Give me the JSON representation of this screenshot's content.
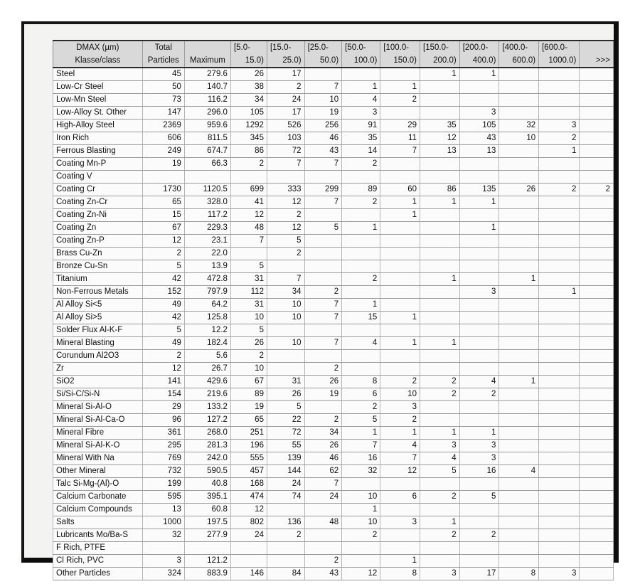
{
  "table": {
    "header": {
      "row1": [
        "DMAX (µm)",
        "Total",
        "",
        "[5.0-",
        "[15.0-",
        "[25.0-",
        "[50.0-",
        "[100.0-",
        "[150.0-",
        "[200.0-",
        "[400.0-",
        "[600.0-",
        ""
      ],
      "row2": [
        "Klasse/class",
        "Particles",
        "Maximum",
        "15.0)",
        "25.0)",
        "50.0)",
        "100.0)",
        "150.0)",
        "200.0)",
        "400.0)",
        "600.0)",
        "1000.0)",
        ">>>"
      ]
    },
    "rows": [
      {
        "label": "Steel",
        "total": "45",
        "maximum": "279.6",
        "bins": [
          "26",
          "17",
          "",
          "",
          "",
          "1",
          "1",
          "",
          "",
          ""
        ]
      },
      {
        "label": "Low-Cr Steel",
        "total": "50",
        "maximum": "140.7",
        "bins": [
          "38",
          "2",
          "7",
          "1",
          "1",
          "",
          "",
          "",
          "",
          ""
        ]
      },
      {
        "label": "Low-Mn Steel",
        "total": "73",
        "maximum": "116.2",
        "bins": [
          "34",
          "24",
          "10",
          "4",
          "2",
          "",
          "",
          "",
          "",
          ""
        ]
      },
      {
        "label": "Low-Alloy St. Other",
        "total": "147",
        "maximum": "296.0",
        "bins": [
          "105",
          "17",
          "19",
          "3",
          "",
          "",
          "3",
          "",
          "",
          ""
        ]
      },
      {
        "label": "High-Alloy Steel",
        "total": "2369",
        "maximum": "959.6",
        "bins": [
          "1292",
          "526",
          "256",
          "91",
          "29",
          "35",
          "105",
          "32",
          "3",
          ""
        ]
      },
      {
        "label": "Iron Rich",
        "total": "606",
        "maximum": "811.5",
        "bins": [
          "345",
          "103",
          "46",
          "35",
          "11",
          "12",
          "43",
          "10",
          "2",
          ""
        ]
      },
      {
        "label": "Ferrous Blasting",
        "total": "249",
        "maximum": "674.7",
        "bins": [
          "86",
          "72",
          "43",
          "14",
          "7",
          "13",
          "13",
          "",
          "1",
          ""
        ]
      },
      {
        "label": "Coating Mn-P",
        "total": "19",
        "maximum": "66.3",
        "bins": [
          "2",
          "7",
          "7",
          "2",
          "",
          "",
          "",
          "",
          "",
          ""
        ]
      },
      {
        "label": "Coating V",
        "total": "",
        "maximum": "",
        "bins": [
          "",
          "",
          "",
          "",
          "",
          "",
          "",
          "",
          "",
          ""
        ]
      },
      {
        "label": "Coating Cr",
        "total": "1730",
        "maximum": "1120.5",
        "bins": [
          "699",
          "333",
          "299",
          "89",
          "60",
          "86",
          "135",
          "26",
          "2",
          "2"
        ]
      },
      {
        "label": "Coating Zn-Cr",
        "total": "65",
        "maximum": "328.0",
        "bins": [
          "41",
          "12",
          "7",
          "2",
          "1",
          "1",
          "1",
          "",
          "",
          ""
        ]
      },
      {
        "label": "Coating Zn-Ni",
        "total": "15",
        "maximum": "117.2",
        "bins": [
          "12",
          "2",
          "",
          "",
          "1",
          "",
          "",
          "",
          "",
          ""
        ]
      },
      {
        "label": "Coating Zn",
        "total": "67",
        "maximum": "229.3",
        "bins": [
          "48",
          "12",
          "5",
          "1",
          "",
          "",
          "1",
          "",
          "",
          ""
        ]
      },
      {
        "label": "Coating Zn-P",
        "total": "12",
        "maximum": "23.1",
        "bins": [
          "7",
          "5",
          "",
          "",
          "",
          "",
          "",
          "",
          "",
          ""
        ]
      },
      {
        "label": "Brass Cu-Zn",
        "total": "2",
        "maximum": "22.0",
        "bins": [
          "",
          "2",
          "",
          "",
          "",
          "",
          "",
          "",
          "",
          ""
        ]
      },
      {
        "label": "Bronze Cu-Sn",
        "total": "5",
        "maximum": "13.9",
        "bins": [
          "5",
          "",
          "",
          "",
          "",
          "",
          "",
          "",
          "",
          ""
        ]
      },
      {
        "label": "Titanium",
        "total": "42",
        "maximum": "472.8",
        "bins": [
          "31",
          "7",
          "",
          "2",
          "",
          "1",
          "",
          "1",
          "",
          ""
        ]
      },
      {
        "label": "Non-Ferrous Metals",
        "total": "152",
        "maximum": "797.9",
        "bins": [
          "112",
          "34",
          "2",
          "",
          "",
          "",
          "3",
          "",
          "1",
          ""
        ]
      },
      {
        "label": "Al Alloy Si<5",
        "total": "49",
        "maximum": "64.2",
        "bins": [
          "31",
          "10",
          "7",
          "1",
          "",
          "",
          "",
          "",
          "",
          ""
        ]
      },
      {
        "label": "Al Alloy Si>5",
        "total": "42",
        "maximum": "125.8",
        "bins": [
          "10",
          "10",
          "7",
          "15",
          "1",
          "",
          "",
          "",
          "",
          ""
        ]
      },
      {
        "label": "Solder Flux Al-K-F",
        "total": "5",
        "maximum": "12.2",
        "bins": [
          "5",
          "",
          "",
          "",
          "",
          "",
          "",
          "",
          "",
          ""
        ]
      },
      {
        "label": "Mineral Blasting",
        "total": "49",
        "maximum": "182.4",
        "bins": [
          "26",
          "10",
          "7",
          "4",
          "1",
          "1",
          "",
          "",
          "",
          ""
        ]
      },
      {
        "label": "Corundum Al2O3",
        "total": "2",
        "maximum": "5.6",
        "bins": [
          "2",
          "",
          "",
          "",
          "",
          "",
          "",
          "",
          "",
          ""
        ]
      },
      {
        "label": "Zr",
        "total": "12",
        "maximum": "26.7",
        "bins": [
          "10",
          "",
          "2",
          "",
          "",
          "",
          "",
          "",
          "",
          ""
        ]
      },
      {
        "label": "SiO2",
        "total": "141",
        "maximum": "429.6",
        "bins": [
          "67",
          "31",
          "26",
          "8",
          "2",
          "2",
          "4",
          "1",
          "",
          ""
        ]
      },
      {
        "label": "Si/Si-C/Si-N",
        "total": "154",
        "maximum": "219.6",
        "bins": [
          "89",
          "26",
          "19",
          "6",
          "10",
          "2",
          "2",
          "",
          "",
          ""
        ]
      },
      {
        "label": "Mineral Si-Al-O",
        "total": "29",
        "maximum": "133.2",
        "bins": [
          "19",
          "5",
          "",
          "2",
          "3",
          "",
          "",
          "",
          "",
          ""
        ]
      },
      {
        "label": "Mineral Si-Al-Ca-O",
        "total": "96",
        "maximum": "127.2",
        "bins": [
          "65",
          "22",
          "2",
          "5",
          "2",
          "",
          "",
          "",
          "",
          ""
        ]
      },
      {
        "label": "Mineral Fibre",
        "total": "361",
        "maximum": "268.0",
        "bins": [
          "251",
          "72",
          "34",
          "1",
          "1",
          "1",
          "1",
          "",
          "",
          ""
        ]
      },
      {
        "label": "Mineral Si-Al-K-O",
        "total": "295",
        "maximum": "281.3",
        "bins": [
          "196",
          "55",
          "26",
          "7",
          "4",
          "3",
          "3",
          "",
          "",
          ""
        ]
      },
      {
        "label": "Mineral With Na",
        "total": "769",
        "maximum": "242.0",
        "bins": [
          "555",
          "139",
          "46",
          "16",
          "7",
          "4",
          "3",
          "",
          "",
          ""
        ]
      },
      {
        "label": "Other Mineral",
        "total": "732",
        "maximum": "590.5",
        "bins": [
          "457",
          "144",
          "62",
          "32",
          "12",
          "5",
          "16",
          "4",
          "",
          ""
        ]
      },
      {
        "label": "Talc Si-Mg-(Al)-O",
        "total": "199",
        "maximum": "40.8",
        "bins": [
          "168",
          "24",
          "7",
          "",
          "",
          "",
          "",
          "",
          "",
          ""
        ]
      },
      {
        "label": "Calcium Carbonate",
        "total": "595",
        "maximum": "395.1",
        "bins": [
          "474",
          "74",
          "24",
          "10",
          "6",
          "2",
          "5",
          "",
          "",
          ""
        ]
      },
      {
        "label": "Calcium Compounds",
        "total": "13",
        "maximum": "60.8",
        "bins": [
          "12",
          "",
          "",
          "1",
          "",
          "",
          "",
          "",
          "",
          ""
        ]
      },
      {
        "label": "Salts",
        "total": "1000",
        "maximum": "197.5",
        "bins": [
          "802",
          "136",
          "48",
          "10",
          "3",
          "1",
          "",
          "",
          "",
          ""
        ]
      },
      {
        "label": "Lubricants Mo/Ba-S",
        "total": "32",
        "maximum": "277.9",
        "bins": [
          "24",
          "2",
          "",
          "2",
          "",
          "2",
          "2",
          "",
          "",
          ""
        ]
      },
      {
        "label": "F Rich, PTFE",
        "total": "",
        "maximum": "",
        "bins": [
          "",
          "",
          "",
          "",
          "",
          "",
          "",
          "",
          "",
          ""
        ]
      },
      {
        "label": "Cl Rich, PVC",
        "total": "3",
        "maximum": "121.2",
        "bins": [
          "",
          "",
          "2",
          "",
          "1",
          "",
          "",
          "",
          "",
          ""
        ]
      },
      {
        "label": "Other Particles",
        "total": "324",
        "maximum": "883.9",
        "bins": [
          "146",
          "84",
          "43",
          "12",
          "8",
          "3",
          "17",
          "8",
          "3",
          ""
        ]
      }
    ]
  },
  "colors": {
    "header_background": "#d9d9d9",
    "cell_background": "#fbfbfb",
    "sheet_background": "#f3f3f1",
    "frame": "#0d0d0d",
    "grid_line": "#b6b6b6",
    "text": "#0f0f0f"
  }
}
